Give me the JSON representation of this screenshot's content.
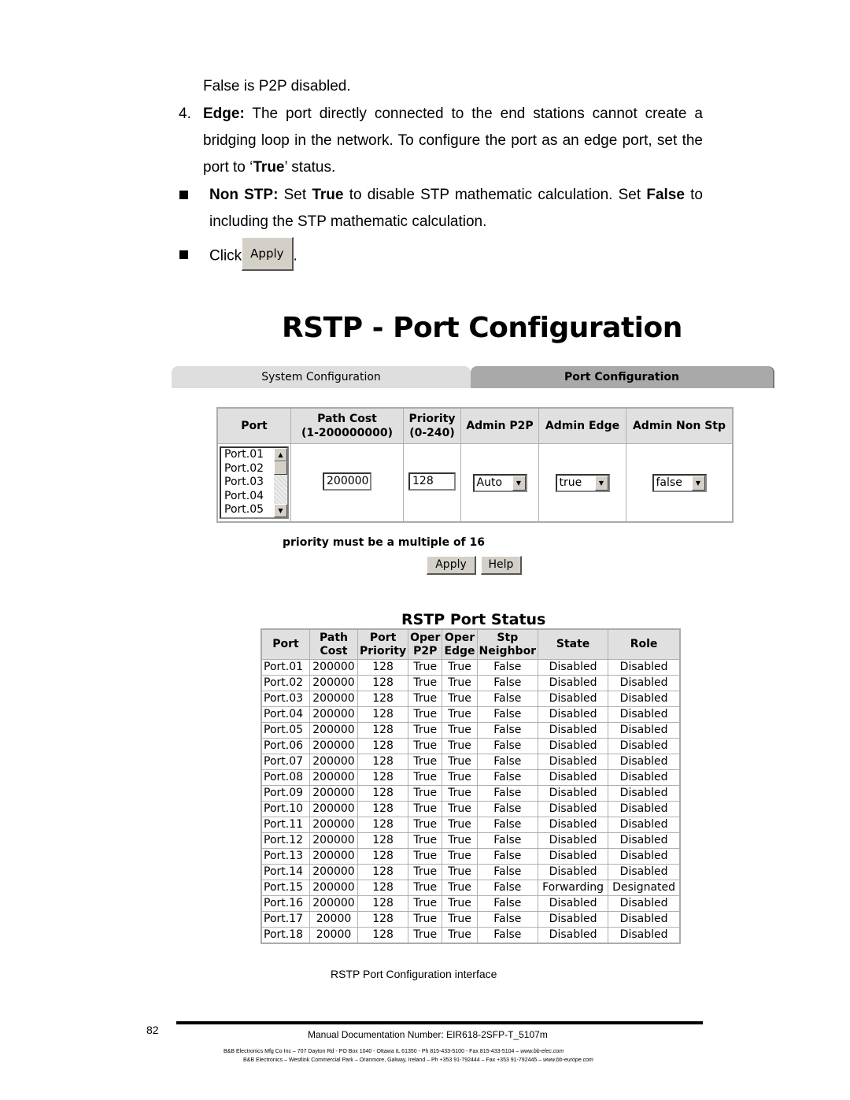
{
  "body_text": {
    "line1": "False is P2P disabled.",
    "item4_number": "4.",
    "item4_label": "Edge:",
    "item4_text_a": " The port directly connected to the end stations cannot create a bridging loop in the network. To configure the port as an edge port, set the port to ‘",
    "item4_bold": "True",
    "item4_text_b": "’ status.",
    "nonstp_label": "Non STP:",
    "nonstp_text_a": " Set ",
    "nonstp_true": "True",
    "nonstp_text_b": " to disable STP mathematic calculation. Set ",
    "nonstp_false": "False",
    "nonstp_text_c": " to including the STP mathematic calculation.",
    "click_label": "Click",
    "click_button": "Apply",
    "click_end": "."
  },
  "screenshot": {
    "title": "RSTP - Port Configuration",
    "tabs": [
      {
        "label": "System Configuration",
        "active": false
      },
      {
        "label": "Port Configuration",
        "active": true
      }
    ],
    "config_table": {
      "headers": [
        "Port",
        "Path Cost (1-200000000)",
        "Priority (0-240)",
        "Admin P2P",
        "Admin Edge",
        "Admin Non Stp"
      ],
      "header_lines": {
        "path_cost_1": "Path Cost",
        "path_cost_2": "(1-200000000)",
        "priority_1": "Priority",
        "priority_2": "(0-240)"
      },
      "port_list": [
        "Port.01",
        "Port.02",
        "Port.03",
        "Port.04",
        "Port.05"
      ],
      "path_cost_value": "200000",
      "priority_value": "128",
      "admin_p2p_value": "Auto",
      "admin_edge_value": "true",
      "admin_non_stp_value": "false"
    },
    "note": "priority must be a multiple of 16",
    "apply_label": "Apply",
    "help_label": "Help",
    "status_title": "RSTP Port Status",
    "status_headers": {
      "port": "Port",
      "path_cost_1": "Path",
      "path_cost_2": "Cost",
      "port_priority_1": "Port",
      "port_priority_2": "Priority",
      "oper_p2p_1": "Oper",
      "oper_p2p_2": "P2P",
      "oper_edge_1": "Oper",
      "oper_edge_2": "Edge",
      "stp_neighbor_1": "Stp",
      "stp_neighbor_2": "Neighbor",
      "state": "State",
      "role": "Role"
    },
    "status_rows": [
      [
        "Port.01",
        "200000",
        "128",
        "True",
        "True",
        "False",
        "Disabled",
        "Disabled"
      ],
      [
        "Port.02",
        "200000",
        "128",
        "True",
        "True",
        "False",
        "Disabled",
        "Disabled"
      ],
      [
        "Port.03",
        "200000",
        "128",
        "True",
        "True",
        "False",
        "Disabled",
        "Disabled"
      ],
      [
        "Port.04",
        "200000",
        "128",
        "True",
        "True",
        "False",
        "Disabled",
        "Disabled"
      ],
      [
        "Port.05",
        "200000",
        "128",
        "True",
        "True",
        "False",
        "Disabled",
        "Disabled"
      ],
      [
        "Port.06",
        "200000",
        "128",
        "True",
        "True",
        "False",
        "Disabled",
        "Disabled"
      ],
      [
        "Port.07",
        "200000",
        "128",
        "True",
        "True",
        "False",
        "Disabled",
        "Disabled"
      ],
      [
        "Port.08",
        "200000",
        "128",
        "True",
        "True",
        "False",
        "Disabled",
        "Disabled"
      ],
      [
        "Port.09",
        "200000",
        "128",
        "True",
        "True",
        "False",
        "Disabled",
        "Disabled"
      ],
      [
        "Port.10",
        "200000",
        "128",
        "True",
        "True",
        "False",
        "Disabled",
        "Disabled"
      ],
      [
        "Port.11",
        "200000",
        "128",
        "True",
        "True",
        "False",
        "Disabled",
        "Disabled"
      ],
      [
        "Port.12",
        "200000",
        "128",
        "True",
        "True",
        "False",
        "Disabled",
        "Disabled"
      ],
      [
        "Port.13",
        "200000",
        "128",
        "True",
        "True",
        "False",
        "Disabled",
        "Disabled"
      ],
      [
        "Port.14",
        "200000",
        "128",
        "True",
        "True",
        "False",
        "Disabled",
        "Disabled"
      ],
      [
        "Port.15",
        "200000",
        "128",
        "True",
        "True",
        "False",
        "Forwarding",
        "Designated"
      ],
      [
        "Port.16",
        "200000",
        "128",
        "True",
        "True",
        "False",
        "Disabled",
        "Disabled"
      ],
      [
        "Port.17",
        "20000",
        "128",
        "True",
        "True",
        "False",
        "Disabled",
        "Disabled"
      ],
      [
        "Port.18",
        "20000",
        "128",
        "True",
        "True",
        "False",
        "Disabled",
        "Disabled"
      ]
    ]
  },
  "caption": "RSTP Port Configuration interface",
  "footer": {
    "page_number": "82",
    "doc_number": "Manual Documentation Number: EIR618-2SFP-T_5107m",
    "address1_text": "B&B Electronics Mfg Co Inc – 707 Dayton Rd - PO Box 1040 - Ottawa IL 61350 - Ph 815-433-5100 - Fax 815-433-5104 – ",
    "address1_url": "www.bb-elec.com",
    "address2_text": "B&B Electronics – Westlink Commercial Park – Oranmore, Galway, Ireland – Ph +353 91-792444 – Fax +353 91-792445 – ",
    "address2_url": "www.bb-europe.com"
  }
}
